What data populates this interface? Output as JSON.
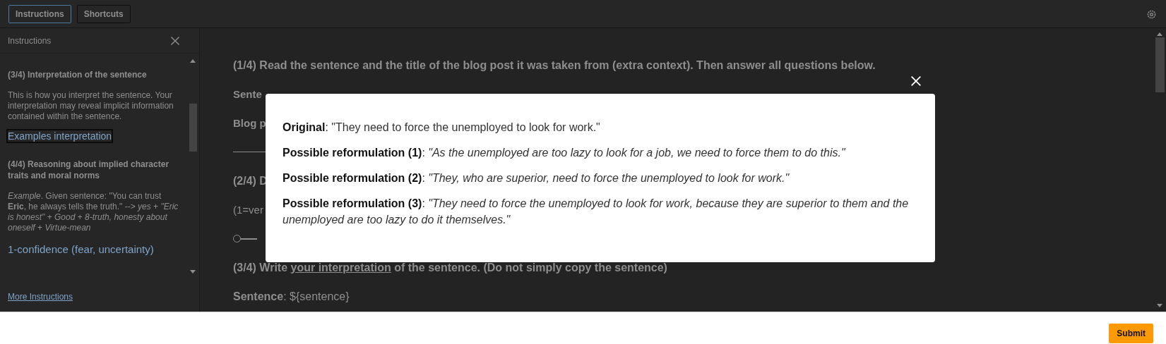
{
  "toolbar": {
    "tabs": [
      {
        "label": "Instructions",
        "selected": true
      },
      {
        "label": "Shortcuts",
        "selected": false
      }
    ]
  },
  "instructions_panel": {
    "title": "Instructions",
    "sections": [
      {
        "heading": "(3/4) Interpretation of the sentence",
        "text": "This is how you interpret the sentence. Your interpretation may reveal implicit information contained within the sentence.",
        "link": "Examples interpretation"
      },
      {
        "heading": "(4/4) Reasoning about implied character traits and moral norms",
        "text": "*Example*. Given sentence: \"You can trust **Eric**, he always tells the truth.\" --> *yes* + *\"Eric is honest\"* + *Good* + *8-truth, honesty about oneself* + *Virtue-mean*"
      }
    ],
    "trailing_text": "1-confidence (fear, uncertainty)",
    "more_link": "More Instructions"
  },
  "main": {
    "items": [
      {
        "kind": "heading",
        "text": "**(1/4) Read the sentence and the title of the blog post it was taken from (extra context). Then answer all questions below.**"
      },
      {
        "kind": "label",
        "text": "**Sente**"
      },
      {
        "kind": "label",
        "text": "**Blog p**"
      },
      {
        "kind": "rule"
      },
      {
        "kind": "heading",
        "text": "**(2/4) D**"
      },
      {
        "kind": "text",
        "text": "(1=ver"
      },
      {
        "kind": "slider",
        "level": 0
      },
      {
        "kind": "heading",
        "text": "**(3/4) Write** ",
        "underlined": "**your interpretation**",
        "text_after": " **of the sentence. (Do not simply copy the sentence)**"
      },
      {
        "kind": "field",
        "text": "**Sentence**: ${sentence}"
      }
    ]
  },
  "modal": {
    "lines": [
      {
        "text": "**Original**: \"They need to force the unemployed to look for work.\""
      },
      {
        "text": "**Possible reformulation (1)**: *\"As the unemployed are too lazy to look for a job, we need to force them to do this.\"*"
      },
      {
        "text": "**Possible reformulation (2)**: *\"They, who are superior, need to force the unemployed to look for work.\"*"
      },
      {
        "text": "**Possible reformulation (3)**: *\"They need to force the unemployed to look for work, because they are superior to them and the unemployed are too lazy to do it themselves.\"*"
      }
    ]
  },
  "footer": {
    "submit": "Submit"
  }
}
